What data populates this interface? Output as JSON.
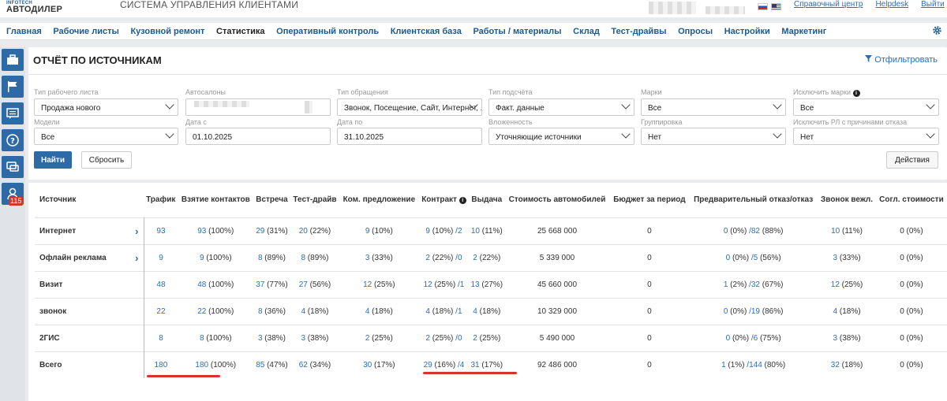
{
  "header": {
    "logo_small": "INFOTECH",
    "logo_big": "АВТОДИЛЕР",
    "system_title": "СИСТЕМА УПРАВЛЕНИЯ КЛИЕНТАМИ",
    "links": [
      "Справочный центр",
      "Helpdesk",
      "Выйти"
    ]
  },
  "nav": [
    "Главная",
    "Рабочие листы",
    "Кузовной ремонт",
    "Статистика",
    "Оперативный контроль",
    "Клиентская база",
    "Работы / материалы",
    "Склад",
    "Тест-драйвы",
    "Опросы",
    "Настройки",
    "Маркетинг"
  ],
  "nav_active": "Статистика",
  "sidebar": {
    "badge": "115"
  },
  "panel": {
    "title": "ОТЧЁТ ПО ИСТОЧНИКАМ",
    "filter_link": "Отфильтровать",
    "filters": {
      "worksheet_type": {
        "label": "Тип рабочего листа",
        "value": "Продажа нового"
      },
      "dealers": {
        "label": "Автосалоны",
        "value": ""
      },
      "request_type": {
        "label": "Тип обращения",
        "value": "Звонок, Посещение, Сайт, Интернет, ...."
      },
      "calc_type": {
        "label": "Тип подсчёта",
        "value": "Факт. данные"
      },
      "brands": {
        "label": "Марки",
        "value": "Все"
      },
      "exclude_brands": {
        "label": "Исключить марки",
        "value": "Все"
      },
      "models": {
        "label": "Модели",
        "value": "Все"
      },
      "date_from": {
        "label": "Дата с",
        "value": "01.10.2025"
      },
      "date_to": {
        "label": "Дата по",
        "value": "31.10.2025"
      },
      "nesting": {
        "label": "Вложенность",
        "value": "Уточняющие источники"
      },
      "grouping": {
        "label": "Группировка",
        "value": "Нет"
      },
      "exclude_reasons": {
        "label": "Исключить РЛ с причинами отказа",
        "value": "Нет"
      }
    },
    "buttons": {
      "find": "Найти",
      "reset": "Сбросить",
      "actions": "Действия"
    }
  },
  "table": {
    "headers": [
      "Источник",
      "Трафик",
      "Взятие контактов",
      "Встреча",
      "Тест-драйв",
      "Ком. предложение",
      "Контракт",
      "Выдача",
      "Стоимость автомобилей",
      "Бюджет за период",
      "Предварительный отказ/отказ",
      "Звонок вежл.",
      "Согл. стоимости"
    ],
    "rows": [
      {
        "source": "Интернет",
        "expand": true,
        "cells": [
          "93",
          "93 (100%)",
          "29 (31%)",
          "20 (22%)",
          "9 (10%)",
          "9 (10%) /2",
          "10 (11%)",
          "25 668 000",
          "0",
          "0 (0%) /82 (88%)",
          "10 (11%)",
          "0 (0%)"
        ]
      },
      {
        "source": "Офлайн реклама",
        "expand": true,
        "cells": [
          "9",
          "9 (100%)",
          "8 (89%)",
          "8 (89%)",
          "3 (33%)",
          "2 (22%) /0",
          "2 (22%)",
          "5 339 000",
          "0",
          "0 (0%) /5 (56%)",
          "3 (33%)",
          "0 (0%)"
        ]
      },
      {
        "source": "Визит",
        "expand": false,
        "cells": [
          "48",
          "48 (100%)",
          "37 (77%)",
          "27 (56%)",
          "12 (25%)",
          "12 (25%) /1",
          "13 (27%)",
          "45 660 000",
          "0",
          "1 (2%) /32 (67%)",
          "12 (25%)",
          "0 (0%)"
        ]
      },
      {
        "source": "звонок",
        "expand": false,
        "cells": [
          "22",
          "22 (100%)",
          "8 (36%)",
          "4 (18%)",
          "4 (18%)",
          "4 (18%) /1",
          "4 (18%)",
          "10 329 000",
          "0",
          "0 (0%) /19 (86%)",
          "4 (18%)",
          "0 (0%)"
        ]
      },
      {
        "source": "2ГИС",
        "expand": false,
        "cells": [
          "8",
          "8 (100%)",
          "3 (38%)",
          "3 (38%)",
          "2 (25%)",
          "2 (25%) /0",
          "2 (25%)",
          "5 490 000",
          "0",
          "0 (0%) /6 (75%)",
          "3 (38%)",
          "0 (0%)"
        ]
      },
      {
        "source": "Всего",
        "expand": false,
        "cells": [
          "180",
          "180 (100%)",
          "85 (47%)",
          "62 (34%)",
          "30 (17%)",
          "29 (16%) /4",
          "31 (17%)",
          "92 486 000",
          "0",
          "1 (1%) /144 (80%)",
          "32 (18%)",
          "0 (0%)"
        ]
      }
    ]
  },
  "colors": {
    "accent": "#2d6aa6",
    "link": "#2a6ebb",
    "annotation": "#d9342b"
  }
}
